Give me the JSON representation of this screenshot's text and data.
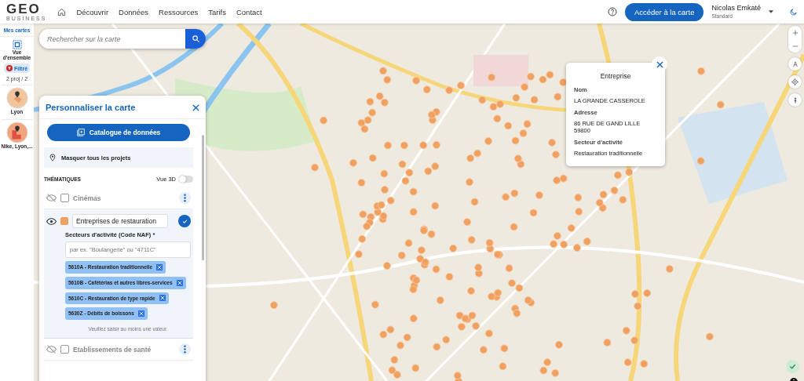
{
  "header": {
    "logo": {
      "name": "GEO",
      "tagline": "BUSINESS"
    },
    "nav": [
      "Découvrir",
      "Données",
      "Ressources",
      "Tarifs",
      "Contact"
    ],
    "cta": "Accéder à la carte",
    "user": {
      "name": "Nicolas Emkaté",
      "plan": "Standard"
    }
  },
  "sidebar": {
    "title": "Mes cartes",
    "overview": "Vue d'ensemble",
    "filter": "Filtré",
    "count": "2 proj / 2",
    "projects": [
      {
        "label": "Lyon",
        "kind": "single"
      },
      {
        "label": "Nike, Lyon,...",
        "kind": "multi"
      }
    ]
  },
  "search": {
    "placeholder": "Rechercher sur la carte"
  },
  "panel": {
    "title": "Personnaliser la carte",
    "catalog_button": "Catalogue de données",
    "hide_projects": "Masquer tous les projets",
    "section": "THÉMATIQUES",
    "view_3d": {
      "label": "Vue 3D",
      "on": false
    },
    "layers": [
      {
        "kind": "collapsed",
        "name": "Cinémas",
        "visible": false,
        "checked": false
      },
      {
        "kind": "expanded",
        "name": "Entreprises de restauration",
        "visible": true,
        "color": "#f0a060",
        "field_label": "Secteurs d'activité (Code NAF) *",
        "placeholder": "par ex. \"Boulangerie\" ou \"4711C\"",
        "tags": [
          "5610A - Restauration traditionnelle",
          "5610B - Cafétérias et autres libres-services",
          "5610C - Restauration de type rapide",
          "5630Z - Débits de boissons"
        ],
        "hint": "Veuillez saisir au moins une valeur."
      },
      {
        "kind": "collapsed",
        "name": "Etablissements de santé",
        "visible": false,
        "checked": false
      }
    ]
  },
  "popup": {
    "title": "Entreprise",
    "fields": [
      {
        "label": "Nom",
        "value": "LA GRANDE CASSEROLE"
      },
      {
        "label": "Adresse",
        "value": "86 RUE DE GAND LILLE 59800"
      },
      {
        "label": "Secteur d'activité",
        "value": "Restauration traditionnelle"
      }
    ]
  }
}
